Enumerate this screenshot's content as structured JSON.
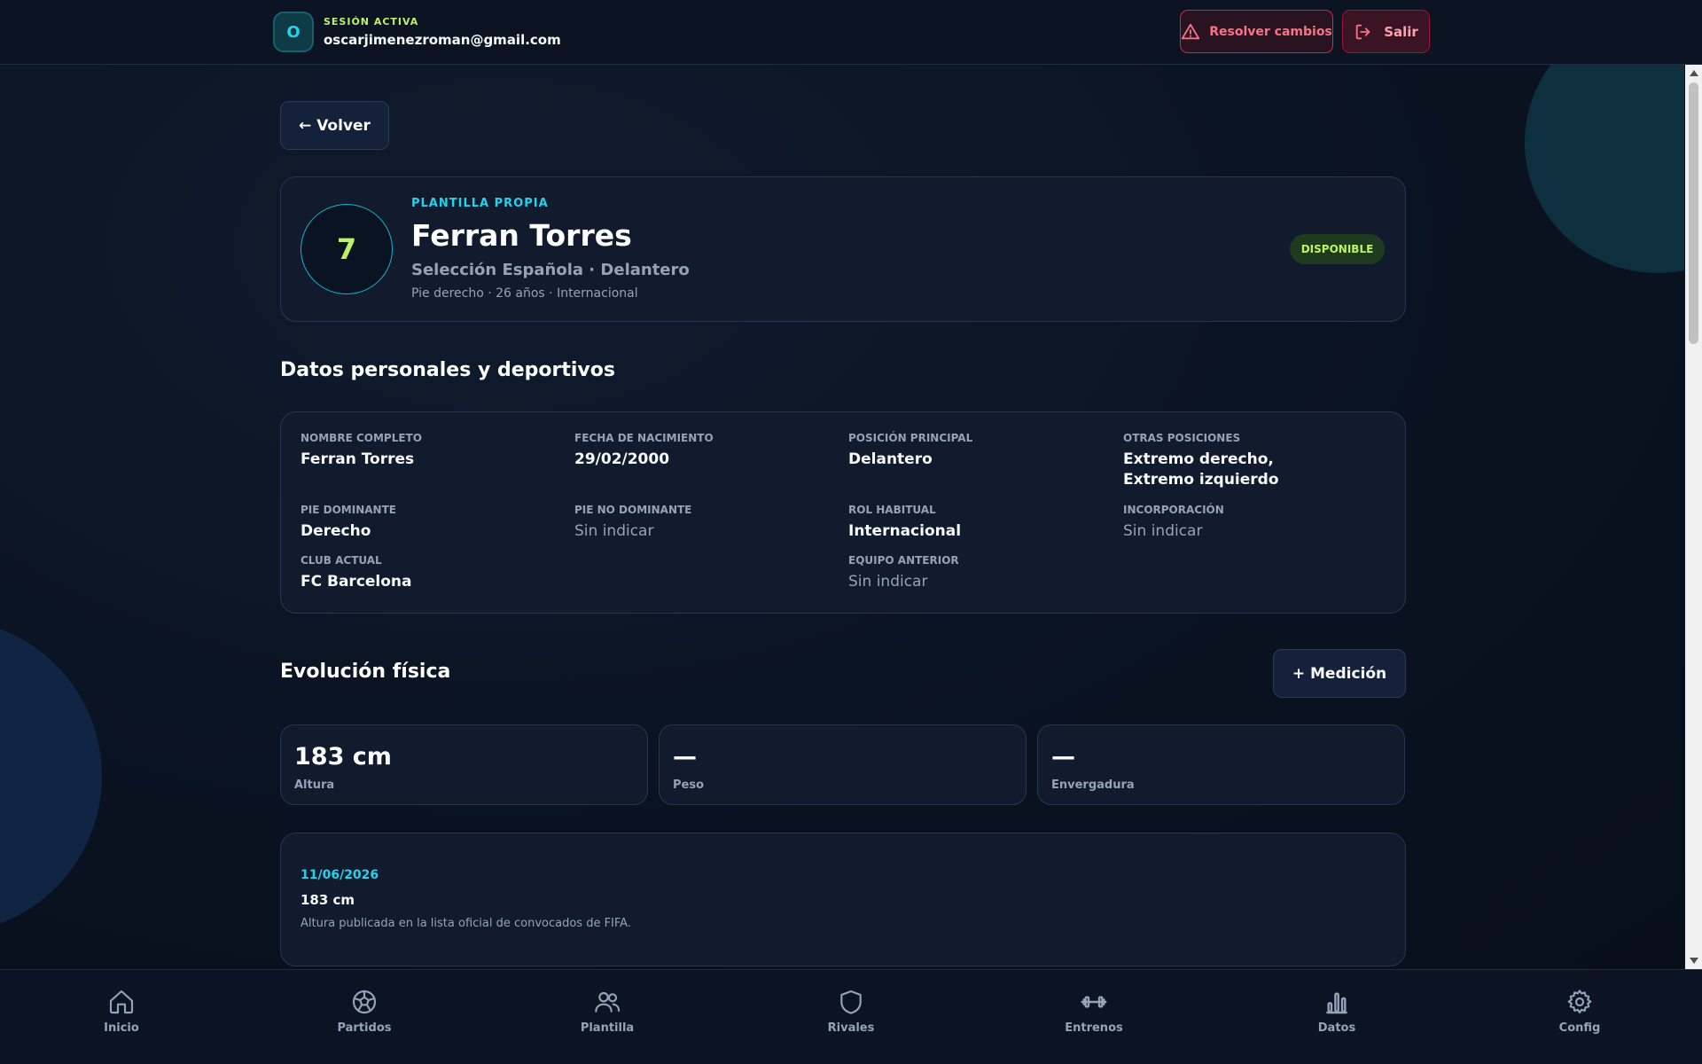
{
  "session": {
    "avatar_letter": "O",
    "label": "SESIÓN ACTIVA",
    "email": "oscarjimenezroman@gmail.com"
  },
  "header": {
    "resolve_label": "Resolver cambios",
    "exit_label": "Salir"
  },
  "back_label": "← Volver",
  "player": {
    "number": "7",
    "squad_label": "PLANTILLA PROPIA",
    "name": "Ferran Torres",
    "subtitle": "Selección Española · Delantero",
    "meta": "Pie derecho · 26 años · Internacional",
    "status": "DISPONIBLE"
  },
  "personal": {
    "title": "Datos personales y deportivos",
    "fields": [
      {
        "label": "NOMBRE COMPLETO",
        "value": "Ferran Torres"
      },
      {
        "label": "FECHA DE NACIMIENTO",
        "value": "29/02/2000"
      },
      {
        "label": "POSICIÓN PRINCIPAL",
        "value": "Delantero"
      },
      {
        "label": "OTRAS POSICIONES",
        "value": "Extremo derecho, Extremo izquierdo"
      },
      {
        "label": "PIE DOMINANTE",
        "value": "Derecho"
      },
      {
        "label": "PIE NO DOMINANTE",
        "value": "Sin indicar"
      },
      {
        "label": "ROL HABITUAL",
        "value": "Internacional"
      },
      {
        "label": "INCORPORACIÓN",
        "value": "Sin indicar"
      },
      {
        "label": "CLUB ACTUAL",
        "value": "FC Barcelona"
      },
      {
        "label": "EQUIPO ANTERIOR",
        "value": "Sin indicar"
      }
    ]
  },
  "physical": {
    "title": "Evolución física",
    "add_label": "+ Medición",
    "metrics": [
      {
        "value": "183 cm",
        "label": "Altura"
      },
      {
        "value": "—",
        "label": "Peso"
      },
      {
        "value": "—",
        "label": "Envergadura"
      }
    ],
    "history": [
      {
        "date": "11/06/2026",
        "value": "183 cm",
        "note": "Altura publicada en la lista oficial de convocados de FIFA."
      }
    ]
  },
  "nav": [
    {
      "label": "Inicio",
      "icon": "home-icon"
    },
    {
      "label": "Partidos",
      "icon": "soccer-ball-icon"
    },
    {
      "label": "Plantilla",
      "icon": "users-icon"
    },
    {
      "label": "Rivales",
      "icon": "shield-icon"
    },
    {
      "label": "Entrenos",
      "icon": "dumbbell-icon"
    },
    {
      "label": "Datos",
      "icon": "bar-chart-icon"
    },
    {
      "label": "Config",
      "icon": "gear-icon"
    }
  ],
  "colors": {
    "accent_cyan": "#22d3ee",
    "accent_lime": "#bef264",
    "danger": "#fb7185",
    "background": "#0b1322",
    "card": "#111b2d"
  }
}
